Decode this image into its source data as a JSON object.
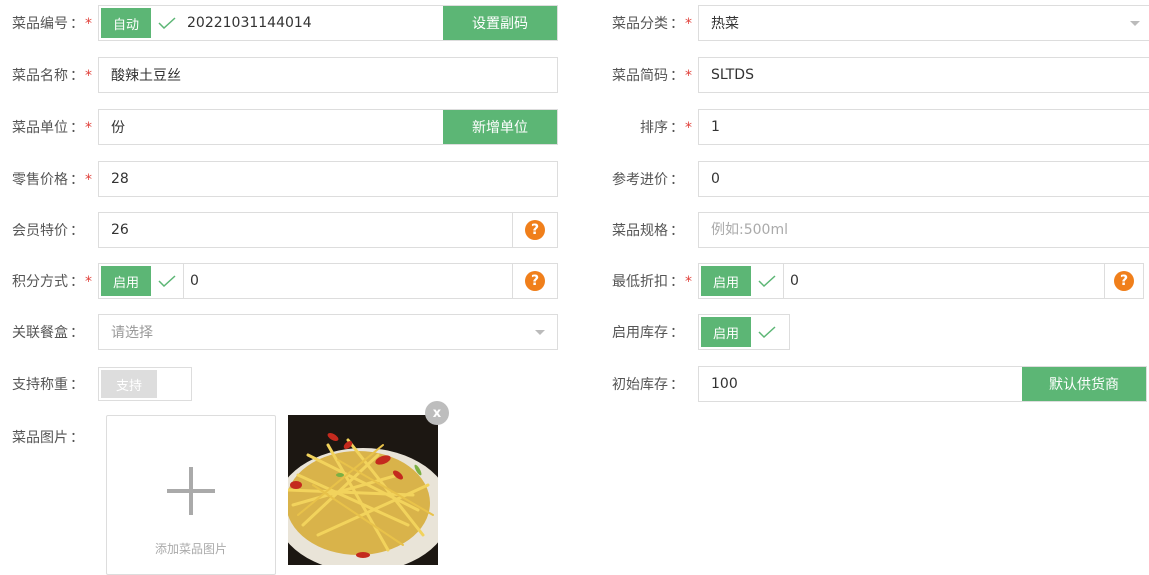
{
  "colors": {
    "accent_green": "#5cb675",
    "required_star": "#e0403a",
    "help_orange": "#f07f1b"
  },
  "required_mark": "*",
  "colon": "：",
  "left": {
    "code": {
      "label": "菜品编号",
      "toggle": "自动",
      "value": "20221031144014",
      "button": "设置副码"
    },
    "name": {
      "label": "菜品名称",
      "value": "酸辣土豆丝"
    },
    "unit": {
      "label": "菜品单位",
      "value": "份",
      "button": "新增单位"
    },
    "retail_price": {
      "label": "零售价格",
      "value": "28"
    },
    "member_price": {
      "label": "会员特价",
      "value": "26",
      "help": "?"
    },
    "points": {
      "label": "积分方式",
      "toggle": "启用",
      "value": "0",
      "help": "?"
    },
    "meal_box": {
      "label": "关联餐盒",
      "placeholder": "请选择"
    },
    "weighing": {
      "label": "支持称重",
      "toggle": "支持"
    },
    "image": {
      "label": "菜品图片",
      "add_caption": "添加菜品图片",
      "remove": "x"
    }
  },
  "right": {
    "category": {
      "label": "菜品分类",
      "value": "热菜"
    },
    "short_code": {
      "label": "菜品简码",
      "value": "SLTDS"
    },
    "sort": {
      "label": "排序",
      "value": "1"
    },
    "cost_price": {
      "label": "参考进价",
      "value": "0"
    },
    "spec": {
      "label": "菜品规格",
      "placeholder": "例如:500ml"
    },
    "min_discount": {
      "label": "最低折扣",
      "toggle": "启用",
      "value": "0",
      "help": "?"
    },
    "stock": {
      "label": "启用库存",
      "toggle": "启用"
    },
    "initial_stock": {
      "label": "初始库存",
      "value": "100",
      "button": "默认供货商"
    }
  }
}
